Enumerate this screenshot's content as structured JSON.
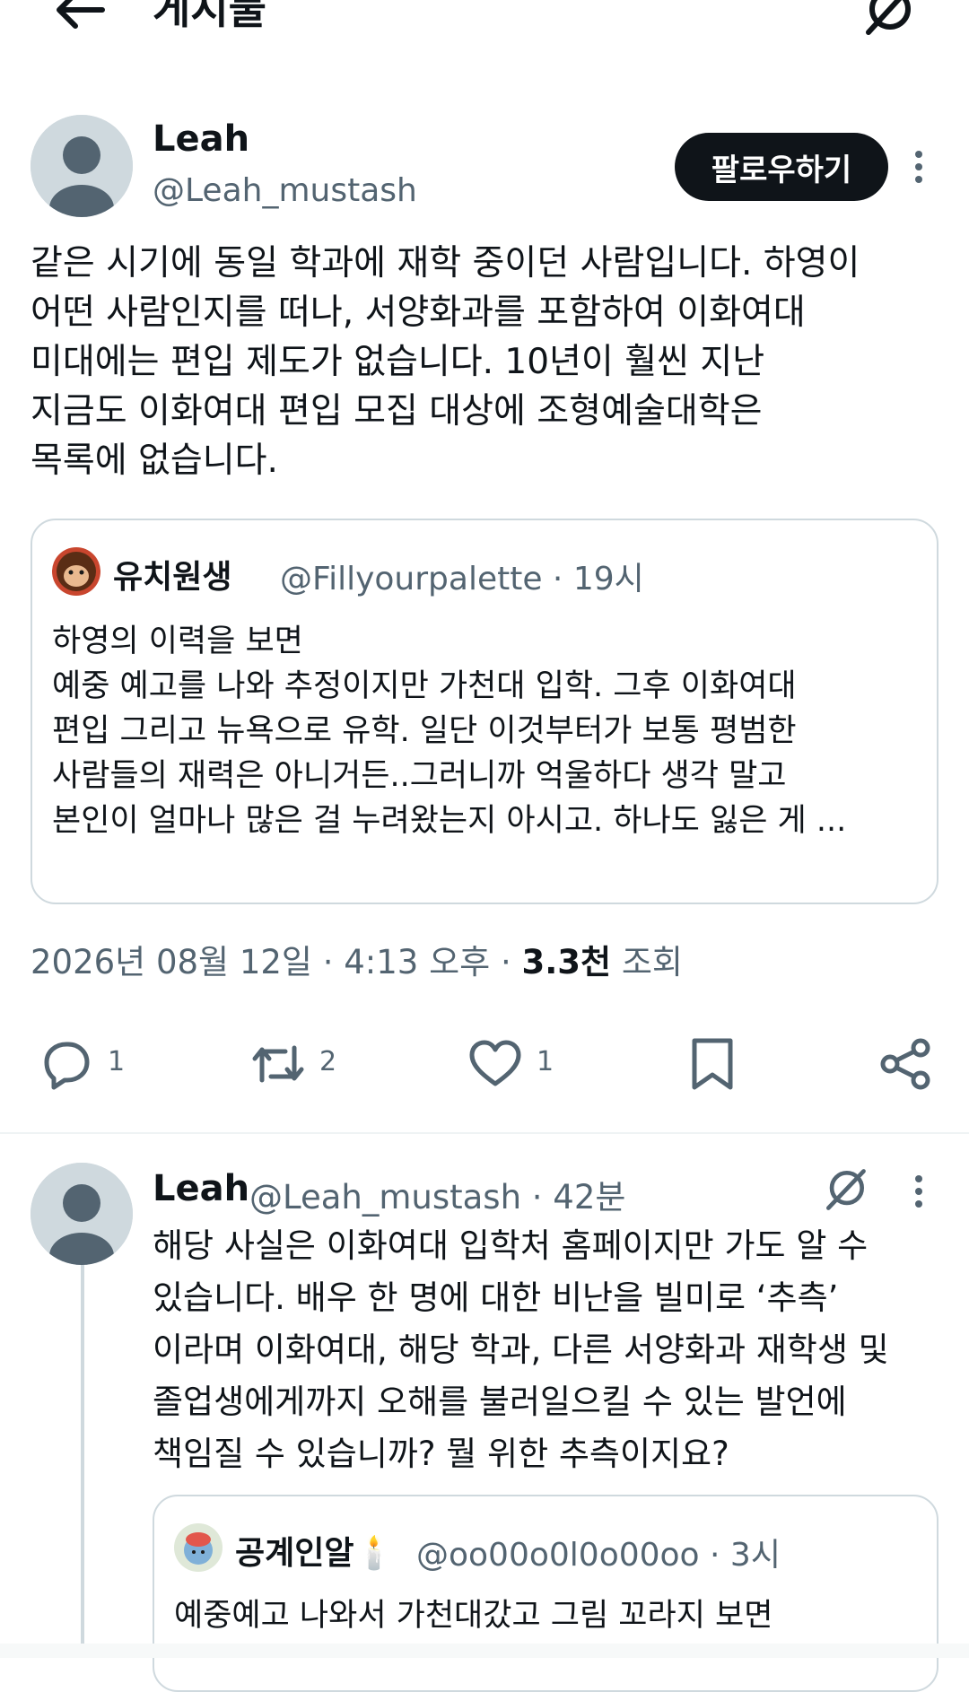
{
  "header": {
    "title": "게시물",
    "back_icon": "arrow-left-icon",
    "grok_icon": "grok-icon"
  },
  "tweet": {
    "author_name": "Leah",
    "author_handle": "@Leah_mustash",
    "follow_label": "팔로우하기",
    "text": "같은 시기에 동일 학과에 재학 중이던 사람입니다. 하영이\n어떤 사람인지를 떠나, 서양화과를 포함하여 이화여대\n미대에는 편입 제도가 없습니다. 10년이 훨씬 지난\n지금도 이화여대 편입 모집 대상에 조형예술대학은\n목록에 없습니다.",
    "quote": {
      "name": "유치원생",
      "handle_time": "@Fillyourpalette · 19시",
      "text": "하영의 이력을 보면\n예중 예고를 나와 추정이지만 가천대 입학. 그후 이화여대\n편입 그리고 뉴욕으로 유학. 일단 이것부터가 보통 평범한\n사람들의 재력은 아니거든..그러니까 억울하다 생각 말고\n본인이 얼마나 많은 걸 누려왔는지 아시고. 하나도 잃은 게 ..."
    },
    "meta": {
      "datetime": "2026년 08월 12일 · 4:13 오후 · ",
      "views": "3.3천",
      "views_label": " 조회"
    },
    "actions": {
      "reply_count": "1",
      "retweet_count": "2",
      "like_count": "1"
    }
  },
  "reply": {
    "author_name": "Leah",
    "handle_time": "@Leah_mustash · 42분",
    "text": "해당 사실은 이화여대 입학처 홈페이지만 가도 알 수\n있습니다. 배우 한 명에 대한 비난을 빌미로 ‘추측’\n이라며 이화여대, 해당 학과, 다른 서양화과 재학생 및\n졸업생에게까지 오해를 불러일으킬 수 있는 발언에\n책임질 수 있습니까? 뭘 위한 추측이지요?",
    "quote": {
      "name": "공계인알🕯️",
      "handle_time": "@oo00o0l0o00oo · 3시",
      "text": "예중예고 나와서 가천대갔고 그림 꼬라지 보면"
    }
  },
  "colors": {
    "text": "#0f1419",
    "secondary": "#536471",
    "border": "#cfd9de",
    "button": "#0f1419"
  }
}
